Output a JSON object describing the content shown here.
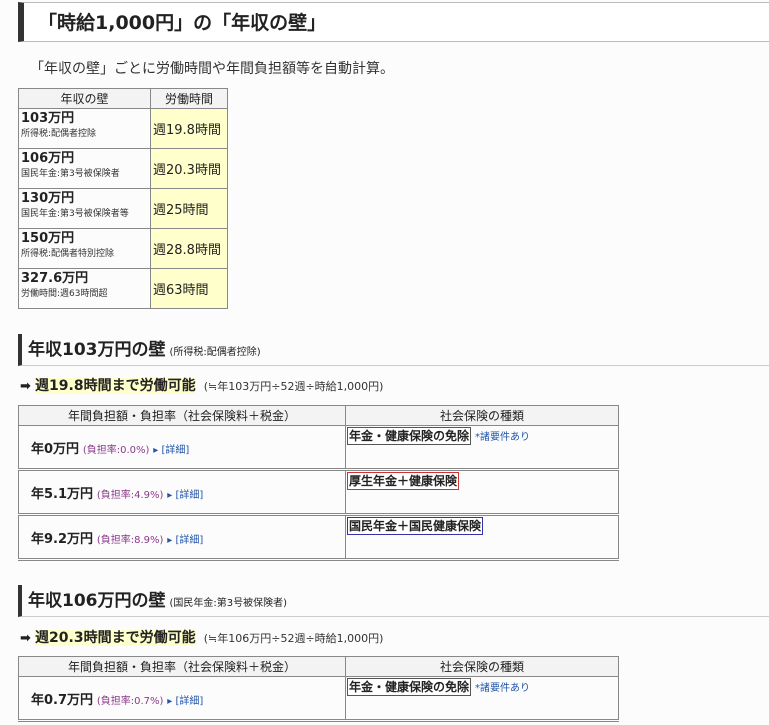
{
  "title": "「時給1,000円」の「年収の壁」",
  "intro": "「年収の壁」ごとに労働時間や年間負担額等を自動計算。",
  "summary": {
    "headers": [
      "年収の壁",
      "労働時間"
    ],
    "rows": [
      {
        "amount": "103万円",
        "sub": "所得税:配偶者控除",
        "hours": "週19.8時間"
      },
      {
        "amount": "106万円",
        "sub": "国民年金:第3号被保険者",
        "hours": "週20.3時間"
      },
      {
        "amount": "130万円",
        "sub": "国民年金:第3号被保険者等",
        "hours": "週25時間"
      },
      {
        "amount": "150万円",
        "sub": "所得税:配偶者特別控除",
        "hours": "週28.8時間"
      },
      {
        "amount": "327.6万円",
        "sub": "労働時間:週63時間超",
        "hours": "週63時間"
      }
    ]
  },
  "sections": [
    {
      "title": "年収103万円の壁",
      "note": "(所得税:配偶者控除)",
      "arrow": "➡",
      "hours_label": "週19.8時間まで労働可能",
      "formula": "(≒年103万円÷52週÷時給1,000円)",
      "headers": [
        "年間負担額・負担率（社会保険料＋税金）",
        "社会保険の種類"
      ],
      "rows": [
        {
          "amount": "年0万円",
          "rate": "(負担率:0.0%)",
          "detail": "▸ [詳細]",
          "insurance": "年金・健康保険の免除",
          "req": "*諸要件あり"
        },
        {
          "amount": "年5.1万円",
          "rate": "(負担率:4.9%)",
          "detail": "▸ [詳細]",
          "insurance": "厚生年金＋健康保険",
          "req": ""
        },
        {
          "amount": "年9.2万円",
          "rate": "(負担率:8.9%)",
          "detail": "▸ [詳細]",
          "insurance": "国民年金＋国民健康保険",
          "req": ""
        }
      ]
    },
    {
      "title": "年収106万円の壁",
      "note": "(国民年金:第3号被保険者)",
      "arrow": "➡",
      "hours_label": "週20.3時間まで労働可能",
      "formula": "(≒年106万円÷52週÷時給1,000円)",
      "headers": [
        "年間負担額・負担率（社会保険料＋税金）",
        "社会保険の種類"
      ],
      "rows": [
        {
          "amount": "年0.7万円",
          "rate": "(負担率:0.7%)",
          "detail": "▸ [詳細]",
          "insurance": "年金・健康保険の免除",
          "req": "*諸要件あり"
        }
      ]
    }
  ]
}
